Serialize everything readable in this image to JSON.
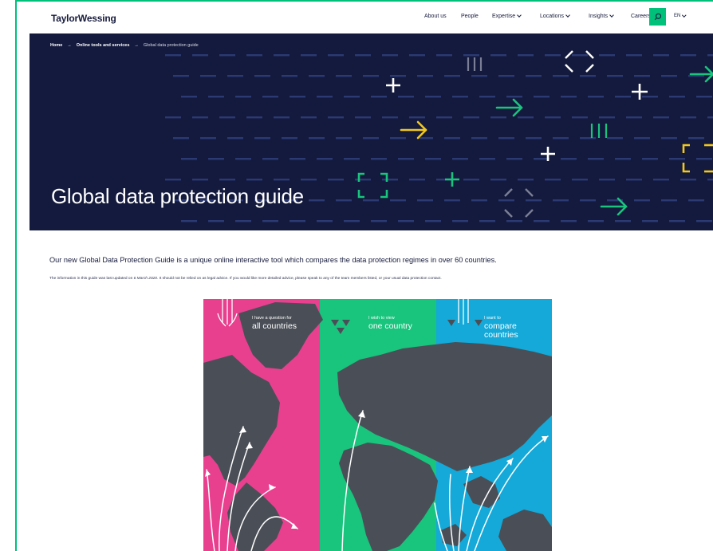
{
  "header": {
    "logo": "TaylorWessing",
    "nav": [
      "About us",
      "People",
      "Expertise",
      "Locations",
      "Insights",
      "Careers"
    ],
    "lang": "EN"
  },
  "breadcrumb": [
    "Home",
    "Online tools and services",
    "Global data protection guide"
  ],
  "hero": {
    "title": "Global data protection guide"
  },
  "intro": "Our new Global Data Protection Guide is a unique online interactive tool which compares the data protection regimes in over 60 countries.",
  "note": {
    "pre": "The information in this guide was last updated on ",
    "date": "6 March 2020",
    "post": ". It should not be relied on as legal advice. If you would like more detailed advice, please speak to any of the team members listed, or your usual data protection contact."
  },
  "panels": [
    {
      "small": "I have a question for",
      "big1": "all countries",
      "big2": ""
    },
    {
      "small": "I wish to view",
      "big1": "one country",
      "big2": ""
    },
    {
      "small": "I want to",
      "big1": "compare",
      "big2": "countries"
    }
  ],
  "colors": {
    "accent_green": "#00c07a",
    "navy": "#141a3d",
    "pink": "#e8408f",
    "green": "#19c47d",
    "blue": "#14a9d8",
    "yellow": "#f2c81d"
  }
}
